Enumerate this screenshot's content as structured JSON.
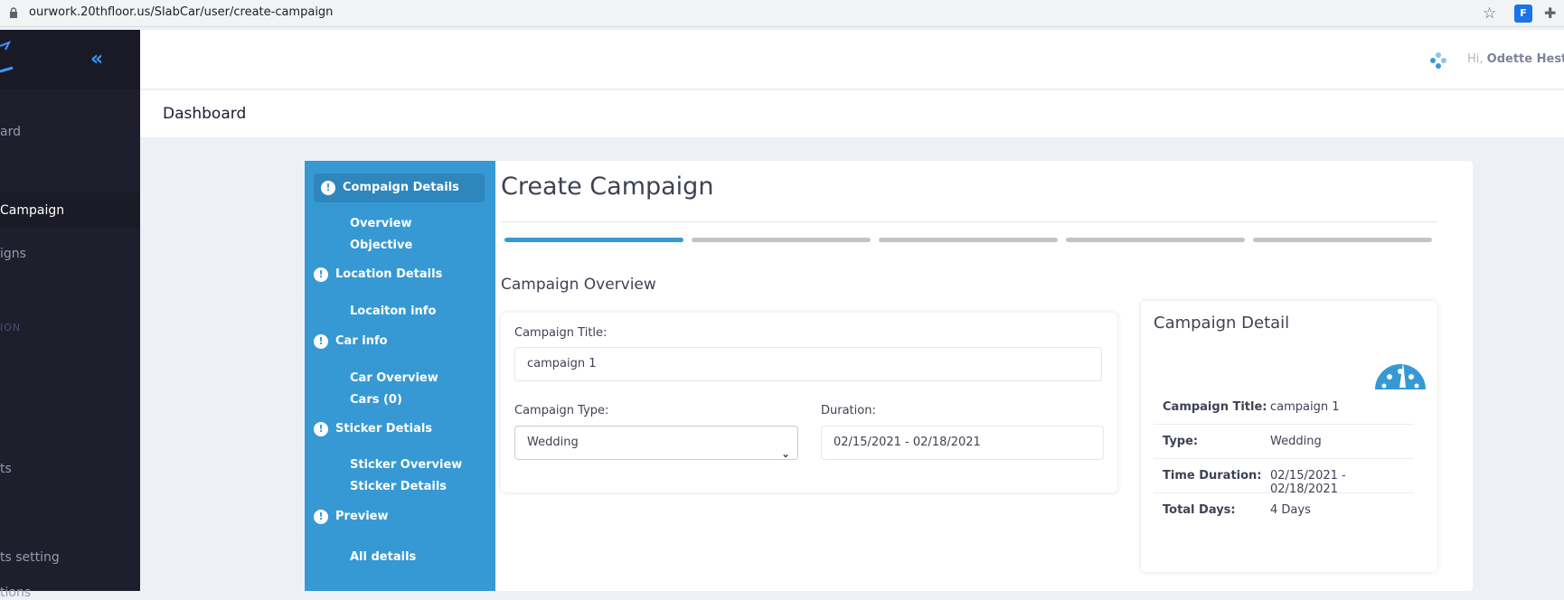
{
  "browser": {
    "url": "ourwork.20thfloor.us/SlabCar/user/create-campaign",
    "ext_label": "F"
  },
  "sidebar": {
    "items": [
      {
        "label": "ard"
      },
      {
        "label": "Campaign"
      },
      {
        "label": "igns"
      },
      {
        "label": "ts"
      },
      {
        "label": "ts setting"
      },
      {
        "label": "tions"
      }
    ],
    "section": "ION"
  },
  "header": {
    "greeting_prefix": "Hi,",
    "user_name": "Odette Hester"
  },
  "subheader": {
    "title": "Dashboard"
  },
  "wizard": {
    "steps": [
      {
        "label": "Compaign Details",
        "subs": [
          "Overview",
          "Objective"
        ]
      },
      {
        "label": "Location Details",
        "subs": [
          "Locaiton info"
        ]
      },
      {
        "label": "Car info",
        "subs": [
          "Car Overview",
          "Cars (0)"
        ]
      },
      {
        "label": "Sticker Detials",
        "subs": [
          "Sticker Overview",
          "Sticker Details"
        ]
      },
      {
        "label": "Preview",
        "subs": [
          "All details"
        ]
      }
    ],
    "step_icon": "!",
    "progress": {
      "current_step": 1,
      "total_steps": 5
    }
  },
  "main": {
    "heading": "Create Campaign",
    "section_title": "Campaign Overview",
    "form": {
      "title_label": "Campaign Title:",
      "title_value": "campaign 1",
      "type_label": "Campaign Type:",
      "type_value": "Wedding",
      "duration_label": "Duration:",
      "duration_value": "02/15/2021 - 02/18/2021"
    }
  },
  "detail": {
    "title": "Campaign Detail",
    "rows": [
      {
        "key": "Campaign Title:",
        "value": "campaign 1"
      },
      {
        "key": "Type:",
        "value": "Wedding"
      },
      {
        "key": "Time Duration:",
        "value": "02/15/2021 - 02/18/2021"
      },
      {
        "key": "Total Days:",
        "value": "4 Days"
      }
    ]
  },
  "colors": {
    "accent": "#3699d4",
    "sidebar_bg": "#1e1e2d",
    "page_bg": "#eef0f8"
  },
  "icons": [
    "lock-icon",
    "star-icon",
    "extension-icon",
    "puzzle-icon",
    "collapse-icon",
    "apps-icon",
    "info-icon",
    "gauge-icon",
    "chevron-down-icon"
  ]
}
